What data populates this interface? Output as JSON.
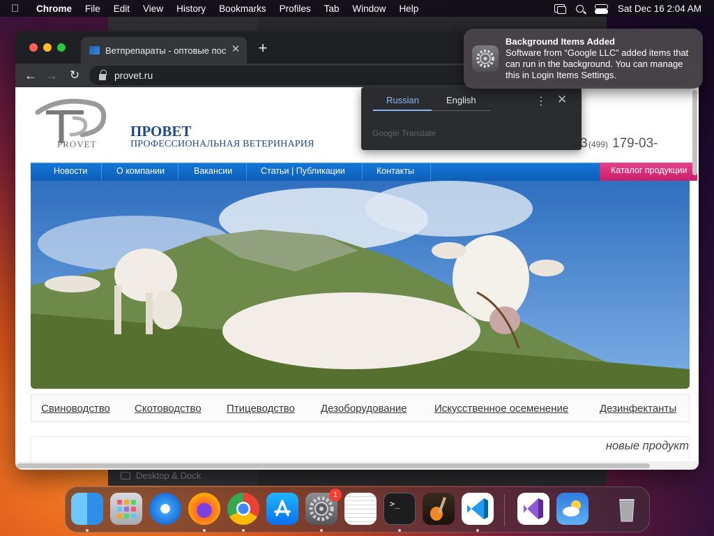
{
  "menubar": {
    "app_name": "Chrome",
    "items": [
      "File",
      "Edit",
      "View",
      "History",
      "Bookmarks",
      "Profiles",
      "Tab",
      "Window",
      "Help"
    ],
    "datetime": "Sat Dec 16  2:04 AM"
  },
  "background_window": {
    "sidebar_label": "Desktop & Dock"
  },
  "browser": {
    "tab_title": "Ветпрепараты - оптовые пос",
    "url": "provet.ru"
  },
  "site": {
    "logo_text": "PROVET",
    "brand_name": "ПРОВЕТ",
    "brand_tagline": "ПРОФЕССИОНАЛЬНАЯ ВЕТЕРИНАРИЯ",
    "phone_left_tail": "3",
    "phone_code": "(499)",
    "phone_number": "179-03-",
    "nav": [
      "Новости",
      "О компании",
      "Вакансии",
      "Статьи | Публикации",
      "Контакты"
    ],
    "catalog_button": "Каталог продукции",
    "categories": [
      "Свиноводство",
      "Скотоводство",
      "Птицеводство",
      "Дезоборудование",
      "Искусственное осеменение",
      "Дезинфектанты"
    ],
    "news_title": "новые продукт"
  },
  "translate_popup": {
    "source_lang": "Russian",
    "target_lang": "English",
    "brand": "Google Translate"
  },
  "notification": {
    "title": "Background Items Added",
    "body": "Software from “Google LLC” added items that can run in the background. You can manage this in Login Items Settings."
  },
  "dock": {
    "apps": [
      "Finder",
      "Launchpad",
      "Safari",
      "Firefox",
      "Google Chrome",
      "App Store",
      "System Settings",
      "TextEdit",
      "Terminal",
      "GarageBand",
      "Visual Studio Code",
      "Visual Studio",
      "Weather",
      "Trash"
    ],
    "settings_badge": "1"
  }
}
